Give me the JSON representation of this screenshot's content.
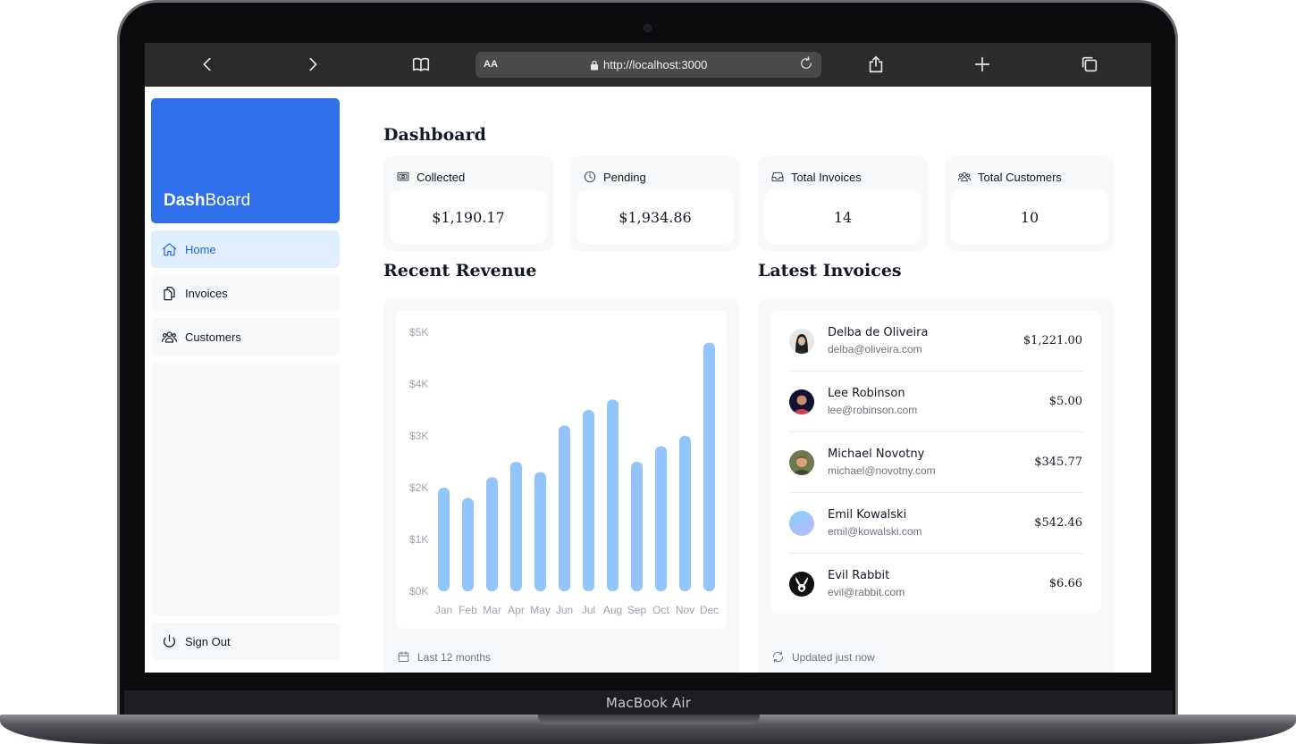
{
  "device": {
    "label": "MacBook Air"
  },
  "browser": {
    "url_prefix_label": "AA",
    "url": "http://localhost:3000"
  },
  "sidebar": {
    "logo_bold": "Dash",
    "logo_rest": "Board",
    "items": [
      {
        "label": "Home",
        "icon": "home-icon",
        "active": true
      },
      {
        "label": "Invoices",
        "icon": "documents-icon",
        "active": false
      },
      {
        "label": "Customers",
        "icon": "users-icon",
        "active": false
      }
    ],
    "sign_out": "Sign Out"
  },
  "page": {
    "title": "Dashboard"
  },
  "cards": [
    {
      "label": "Collected",
      "value": "$1,190.17",
      "icon": "banknote-icon"
    },
    {
      "label": "Pending",
      "value": "$1,934.86",
      "icon": "clock-icon"
    },
    {
      "label": "Total Invoices",
      "value": "14",
      "icon": "inbox-icon"
    },
    {
      "label": "Total Customers",
      "value": "10",
      "icon": "users-icon"
    }
  ],
  "revenue": {
    "title": "Recent Revenue",
    "footer": "Last 12 months",
    "y_ticks": [
      "$5K",
      "$4K",
      "$3K",
      "$2K",
      "$1K",
      "$0K"
    ],
    "bar_color": "#93c5fd"
  },
  "chart_data": {
    "type": "bar",
    "title": "",
    "xlabel": "",
    "ylabel": "",
    "categories": [
      "Jan",
      "Feb",
      "Mar",
      "Apr",
      "May",
      "Jun",
      "Jul",
      "Aug",
      "Sep",
      "Oct",
      "Nov",
      "Dec"
    ],
    "values": [
      2000,
      1800,
      2200,
      2500,
      2300,
      3200,
      3500,
      3700,
      2500,
      2800,
      3000,
      4800
    ],
    "ylim": [
      0,
      5000
    ],
    "grid": false
  },
  "invoices": {
    "title": "Latest Invoices",
    "footer": "Updated just now",
    "rows": [
      {
        "name": "Delba de Oliveira",
        "email": "delba@oliveira.com",
        "amount": "$1,221.00"
      },
      {
        "name": "Lee Robinson",
        "email": "lee@robinson.com",
        "amount": "$5.00"
      },
      {
        "name": "Michael Novotny",
        "email": "michael@novotny.com",
        "amount": "$345.77"
      },
      {
        "name": "Emil Kowalski",
        "email": "emil@kowalski.com",
        "amount": "$542.46"
      },
      {
        "name": "Evil Rabbit",
        "email": "evil@rabbit.com",
        "amount": "$6.66"
      }
    ]
  },
  "colors": {
    "brand": "#2f6fea",
    "active_nav_bg": "#e0effe",
    "active_nav_text": "#2563eb"
  }
}
